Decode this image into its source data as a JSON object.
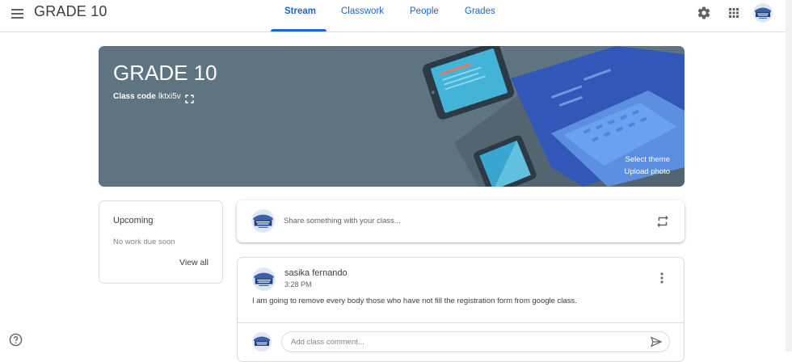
{
  "app": {
    "title": "GRADE 10"
  },
  "tabs": [
    {
      "label": "Stream",
      "active": true
    },
    {
      "label": "Classwork",
      "active": false
    },
    {
      "label": "People",
      "active": false
    },
    {
      "label": "Grades",
      "active": false
    }
  ],
  "header_icons": [
    "menu-icon",
    "gear-icon",
    "apps-grid-icon",
    "account-avatar"
  ],
  "banner": {
    "title": "GRADE 10",
    "class_code_label": "Class code",
    "class_code": "lktxi5v",
    "select_theme": "Select theme",
    "upload_photo": "Upload photo",
    "color": "#5e7480"
  },
  "upcoming": {
    "title": "Upcoming",
    "empty_text": "No work due soon",
    "view_all": "View all"
  },
  "share": {
    "placeholder": "Share something with your class..."
  },
  "post": {
    "author": "sasika fernando",
    "time": "3:28 PM",
    "text": "I am going to remove every body those who have not fill the registration form from google class.",
    "comment_placeholder": "Add class comment..."
  },
  "colors": {
    "accent": "#1967d2",
    "banner": "#5e7480"
  }
}
